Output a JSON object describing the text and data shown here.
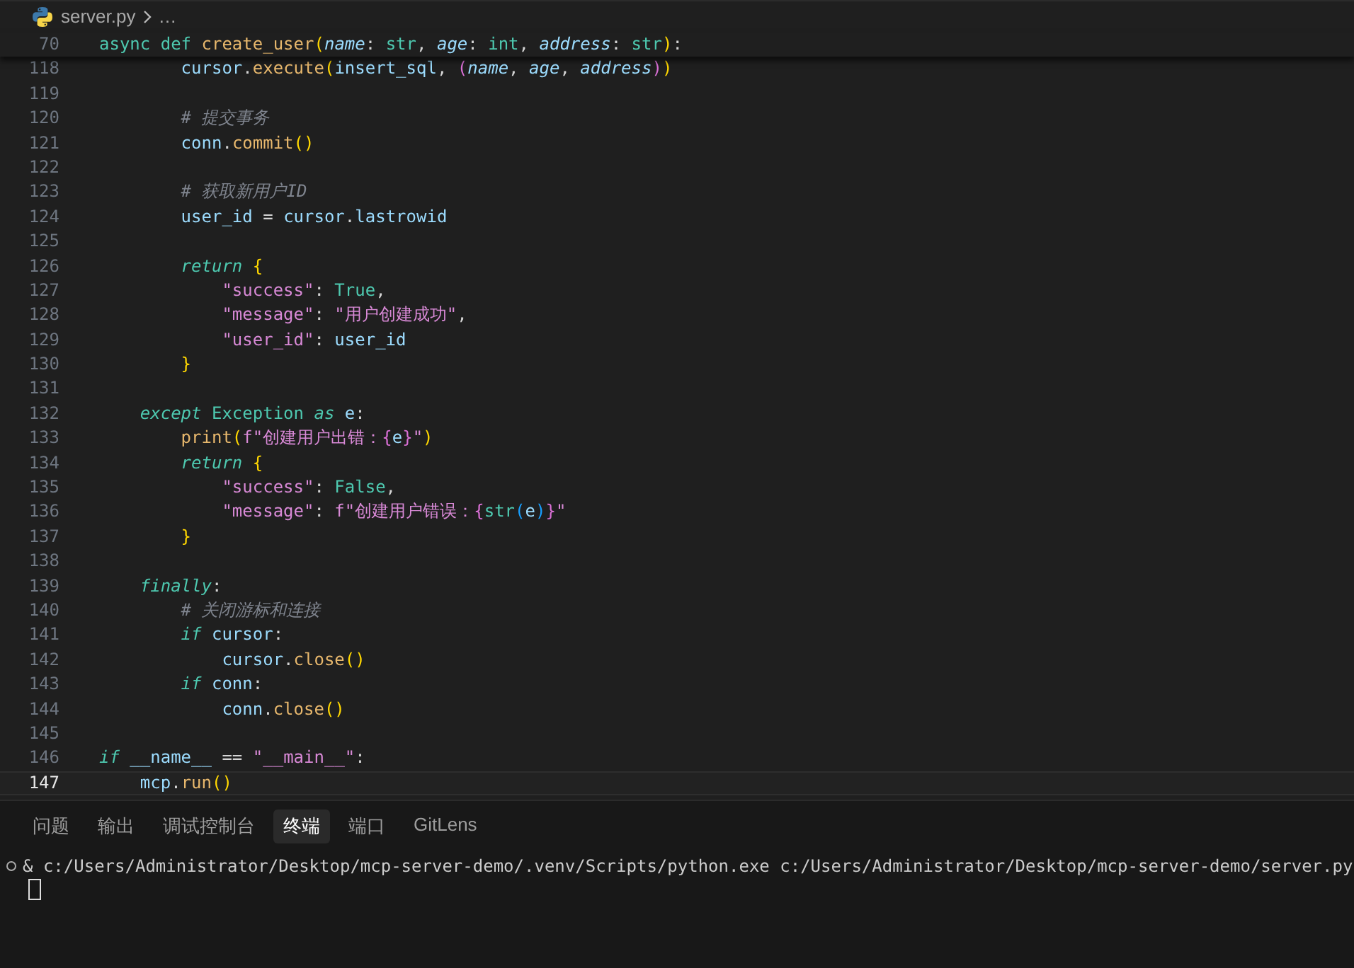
{
  "breadcrumb": {
    "file": "server.py",
    "more": "…"
  },
  "sticky_line": {
    "number": "70",
    "tokens": [
      {
        "kind": "kw",
        "text": "async def "
      },
      {
        "kind": "fn",
        "text": "create_user"
      },
      {
        "kind": "b1",
        "text": "("
      },
      {
        "kind": "param",
        "text": "name"
      },
      {
        "kind": "op",
        "text": ": "
      },
      {
        "kind": "type",
        "text": "str"
      },
      {
        "kind": "op",
        "text": ", "
      },
      {
        "kind": "param",
        "text": "age"
      },
      {
        "kind": "op",
        "text": ": "
      },
      {
        "kind": "type",
        "text": "int"
      },
      {
        "kind": "op",
        "text": ", "
      },
      {
        "kind": "param",
        "text": "address"
      },
      {
        "kind": "op",
        "text": ": "
      },
      {
        "kind": "type",
        "text": "str"
      },
      {
        "kind": "b1",
        "text": ")"
      },
      {
        "kind": "op",
        "text": ":"
      }
    ]
  },
  "lines": [
    {
      "number": "118",
      "current": false,
      "tokens": [
        {
          "kind": "var",
          "text": "        cursor"
        },
        {
          "kind": "op",
          "text": "."
        },
        {
          "kind": "fn",
          "text": "execute"
        },
        {
          "kind": "b1",
          "text": "("
        },
        {
          "kind": "var",
          "text": "insert_sql"
        },
        {
          "kind": "op",
          "text": ", "
        },
        {
          "kind": "b2",
          "text": "("
        },
        {
          "kind": "param",
          "text": "name"
        },
        {
          "kind": "op",
          "text": ", "
        },
        {
          "kind": "param",
          "text": "age"
        },
        {
          "kind": "op",
          "text": ", "
        },
        {
          "kind": "param",
          "text": "address"
        },
        {
          "kind": "b2",
          "text": ")"
        },
        {
          "kind": "b1",
          "text": ")"
        }
      ]
    },
    {
      "number": "119",
      "current": false
    },
    {
      "number": "120",
      "current": false,
      "tokens": [
        {
          "kind": "comment",
          "text": "        # 提交事务"
        }
      ]
    },
    {
      "number": "121",
      "current": false,
      "tokens": [
        {
          "kind": "var",
          "text": "        conn"
        },
        {
          "kind": "op",
          "text": "."
        },
        {
          "kind": "fn",
          "text": "commit"
        },
        {
          "kind": "b1",
          "text": "()"
        }
      ]
    },
    {
      "number": "122",
      "current": false
    },
    {
      "number": "123",
      "current": false,
      "tokens": [
        {
          "kind": "comment",
          "text": "        # 获取新用户ID"
        }
      ]
    },
    {
      "number": "124",
      "current": false,
      "tokens": [
        {
          "kind": "var",
          "text": "        user_id"
        },
        {
          "kind": "op",
          "text": " = "
        },
        {
          "kind": "var",
          "text": "cursor"
        },
        {
          "kind": "op",
          "text": "."
        },
        {
          "kind": "var",
          "text": "lastrowid"
        }
      ]
    },
    {
      "number": "125",
      "current": false
    },
    {
      "number": "126",
      "current": false,
      "tokens": [
        {
          "kind": "ctrl",
          "text": "        return"
        },
        {
          "kind": "b1",
          "text": " {"
        }
      ]
    },
    {
      "number": "127",
      "current": false,
      "tokens": [
        {
          "kind": "str",
          "text": "            \"success\""
        },
        {
          "kind": "op",
          "text": ": "
        },
        {
          "kind": "const",
          "text": "True"
        },
        {
          "kind": "op",
          "text": ","
        }
      ]
    },
    {
      "number": "128",
      "current": false,
      "tokens": [
        {
          "kind": "str",
          "text": "            \"message\""
        },
        {
          "kind": "op",
          "text": ": "
        },
        {
          "kind": "str",
          "text": "\"用户创建成功\""
        },
        {
          "kind": "op",
          "text": ","
        }
      ]
    },
    {
      "number": "129",
      "current": false,
      "tokens": [
        {
          "kind": "str",
          "text": "            \"user_id\""
        },
        {
          "kind": "op",
          "text": ": "
        },
        {
          "kind": "var",
          "text": "user_id"
        }
      ]
    },
    {
      "number": "130",
      "current": false,
      "tokens": [
        {
          "kind": "b1",
          "text": "        }"
        }
      ]
    },
    {
      "number": "131",
      "current": false
    },
    {
      "number": "132",
      "current": false,
      "tokens": [
        {
          "kind": "ctrl",
          "text": "    except"
        },
        {
          "kind": "type",
          "text": " Exception "
        },
        {
          "kind": "ctrl",
          "text": "as"
        },
        {
          "kind": "var",
          "text": " e"
        },
        {
          "kind": "op",
          "text": ":"
        }
      ]
    },
    {
      "number": "133",
      "current": false,
      "tokens": [
        {
          "kind": "fn",
          "text": "        print"
        },
        {
          "kind": "b1",
          "text": "("
        },
        {
          "kind": "str",
          "text": "f\"创建用户出错："
        },
        {
          "kind": "b2",
          "text": "{"
        },
        {
          "kind": "var",
          "text": "e"
        },
        {
          "kind": "b2",
          "text": "}"
        },
        {
          "kind": "str",
          "text": "\""
        },
        {
          "kind": "b1",
          "text": ")"
        }
      ]
    },
    {
      "number": "134",
      "current": false,
      "tokens": [
        {
          "kind": "ctrl",
          "text": "        return"
        },
        {
          "kind": "b1",
          "text": " {"
        }
      ]
    },
    {
      "number": "135",
      "current": false,
      "tokens": [
        {
          "kind": "str",
          "text": "            \"success\""
        },
        {
          "kind": "op",
          "text": ": "
        },
        {
          "kind": "const",
          "text": "False"
        },
        {
          "kind": "op",
          "text": ","
        }
      ]
    },
    {
      "number": "136",
      "current": false,
      "tokens": [
        {
          "kind": "str",
          "text": "            \"message\""
        },
        {
          "kind": "op",
          "text": ": "
        },
        {
          "kind": "str",
          "text": "f\"创建用户错误："
        },
        {
          "kind": "b2",
          "text": "{"
        },
        {
          "kind": "type",
          "text": "str"
        },
        {
          "kind": "b3",
          "text": "("
        },
        {
          "kind": "var",
          "text": "e"
        },
        {
          "kind": "b3",
          "text": ")"
        },
        {
          "kind": "b2",
          "text": "}"
        },
        {
          "kind": "str",
          "text": "\""
        }
      ]
    },
    {
      "number": "137",
      "current": false,
      "tokens": [
        {
          "kind": "b1",
          "text": "        }"
        }
      ]
    },
    {
      "number": "138",
      "current": false
    },
    {
      "number": "139",
      "current": false,
      "tokens": [
        {
          "kind": "ctrl",
          "text": "    finally"
        },
        {
          "kind": "op",
          "text": ":"
        }
      ]
    },
    {
      "number": "140",
      "current": false,
      "tokens": [
        {
          "kind": "comment",
          "text": "        # 关闭游标和连接"
        }
      ]
    },
    {
      "number": "141",
      "current": false,
      "tokens": [
        {
          "kind": "ctrl",
          "text": "        if"
        },
        {
          "kind": "var",
          "text": " cursor"
        },
        {
          "kind": "op",
          "text": ":"
        }
      ]
    },
    {
      "number": "142",
      "current": false,
      "tokens": [
        {
          "kind": "var",
          "text": "            cursor"
        },
        {
          "kind": "op",
          "text": "."
        },
        {
          "kind": "fn",
          "text": "close"
        },
        {
          "kind": "b1",
          "text": "()"
        }
      ]
    },
    {
      "number": "143",
      "current": false,
      "tokens": [
        {
          "kind": "ctrl",
          "text": "        if"
        },
        {
          "kind": "var",
          "text": " conn"
        },
        {
          "kind": "op",
          "text": ":"
        }
      ]
    },
    {
      "number": "144",
      "current": false,
      "tokens": [
        {
          "kind": "var",
          "text": "            conn"
        },
        {
          "kind": "op",
          "text": "."
        },
        {
          "kind": "fn",
          "text": "close"
        },
        {
          "kind": "b1",
          "text": "()"
        }
      ]
    },
    {
      "number": "145",
      "current": false
    },
    {
      "number": "146",
      "current": false,
      "tokens": [
        {
          "kind": "ctrl",
          "text": "if"
        },
        {
          "kind": "var",
          "text": " __name__"
        },
        {
          "kind": "op",
          "text": " == "
        },
        {
          "kind": "str",
          "text": "\"__main__\""
        },
        {
          "kind": "op",
          "text": ":"
        }
      ]
    },
    {
      "number": "147",
      "current": true,
      "tokens": [
        {
          "kind": "var",
          "text": "    mcp"
        },
        {
          "kind": "op",
          "text": "."
        },
        {
          "kind": "fn",
          "text": "run"
        },
        {
          "kind": "b1",
          "text": "()"
        }
      ]
    }
  ],
  "panel_tabs": [
    {
      "label": "问题",
      "selected": false
    },
    {
      "label": "输出",
      "selected": false
    },
    {
      "label": "调试控制台",
      "selected": false
    },
    {
      "label": "终端",
      "selected": true
    },
    {
      "label": "端口",
      "selected": false
    },
    {
      "label": "GitLens",
      "selected": false
    }
  ],
  "terminal": {
    "command": "& c:/Users/Administrator/Desktop/mcp-server-demo/.venv/Scripts/python.exe c:/Users/Administrator/Desktop/mcp-server-demo/server.py"
  }
}
